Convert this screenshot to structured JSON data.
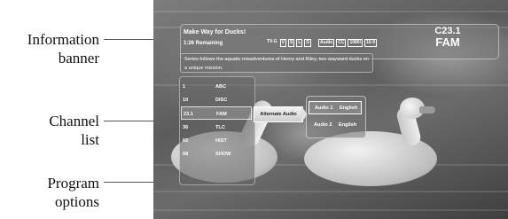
{
  "callouts": {
    "information_banner": [
      "Information",
      "banner"
    ],
    "channel_list": [
      "Channel",
      "list"
    ],
    "program_options": [
      "Program",
      "options"
    ]
  },
  "banner": {
    "title": "Make Way for Ducks!",
    "remaining": "1:26 Remaining",
    "badges": [
      "TV-G",
      "V",
      "S",
      "L",
      "D",
      "Audio",
      "CC",
      "1080i",
      "16:9"
    ],
    "channel_number": "C23.1",
    "channel_name": "FAM",
    "synopsis": "Series follows the aquatic misadventures of Henry and Riley, two wayward ducks on a unique mission."
  },
  "channel_list": [
    {
      "number": "1",
      "name": "ABC"
    },
    {
      "number": "10",
      "name": "DISC"
    },
    {
      "number": "23.1",
      "name": "FAM",
      "selected": true
    },
    {
      "number": "36",
      "name": "TLC"
    },
    {
      "number": "65",
      "name": "HIST"
    },
    {
      "number": "68",
      "name": "SHOW"
    }
  ],
  "program_options": {
    "menu_label": "Alternate Audio",
    "audio_options": [
      {
        "label": "Audio 1",
        "language": "English",
        "selected": true
      },
      {
        "label": "Audio 2",
        "language": "English"
      }
    ]
  }
}
